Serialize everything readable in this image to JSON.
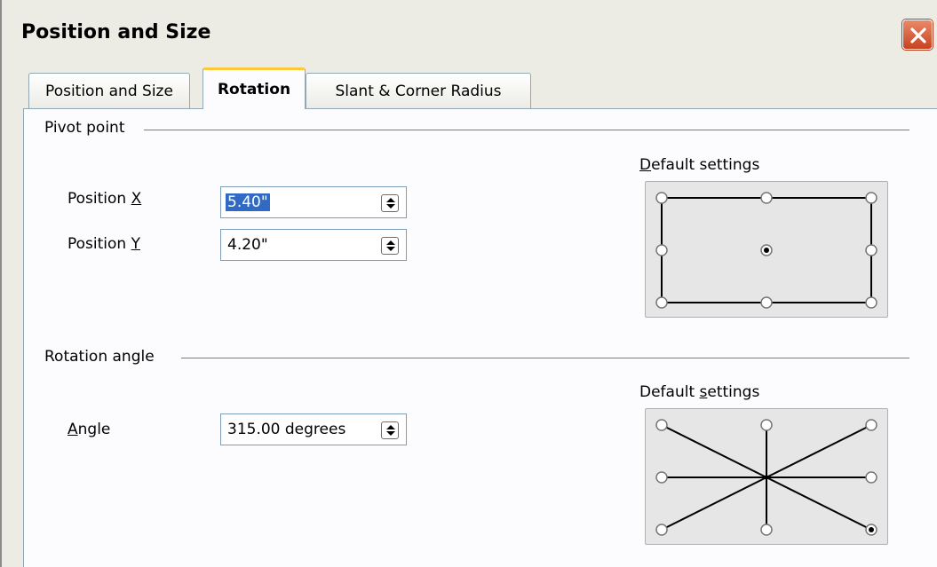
{
  "window": {
    "title": "Position and Size",
    "close_icon": "close-icon"
  },
  "tabs": [
    {
      "label": "Position and Size",
      "active": false
    },
    {
      "label": "Rotation",
      "active": true
    },
    {
      "label": "Slant & Corner Radius",
      "active": false
    }
  ],
  "pivot": {
    "group_title": "Pivot point",
    "x_label_prefix": "Position ",
    "x_label_key": "X",
    "x_value": "5.40\"",
    "y_label_prefix": "Position ",
    "y_label_key": "Y",
    "y_value": "4.20\"",
    "defaults_prefix": "",
    "defaults_key": "D",
    "defaults_suffix": "efault settings",
    "selected_point": "center"
  },
  "rotation": {
    "group_title": "Rotation angle",
    "angle_label_key": "A",
    "angle_label_suffix": "ngle",
    "angle_value": "315.00 degrees",
    "defaults_prefix": "Default ",
    "defaults_key": "s",
    "defaults_suffix": "ettings",
    "selected_point": "bottom-right"
  },
  "colors": {
    "dialog_bg": "#ecebe4",
    "panel_bg": "#fcfcfe",
    "active_tab_accent": "#ffc73c",
    "selection": "#316ac5",
    "close_button": "#c8421f"
  }
}
